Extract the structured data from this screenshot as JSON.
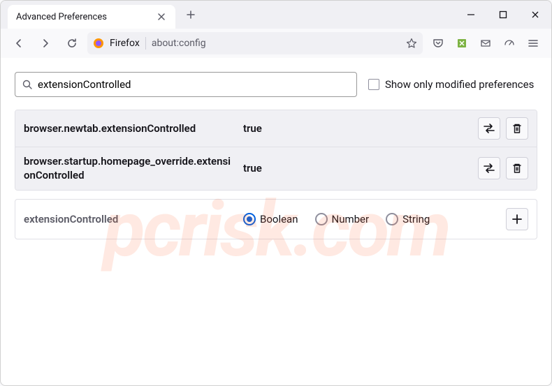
{
  "tab": {
    "title": "Advanced Preferences"
  },
  "urlbar": {
    "identity": "Firefox",
    "url": "about:config"
  },
  "search": {
    "value": "extensionControlled",
    "checkbox_label": "Show only modified preferences"
  },
  "prefs": [
    {
      "name": "browser.newtab.extensionControlled",
      "value": "true"
    },
    {
      "name": "browser.startup.homepage_override.extensionControlled",
      "value": "true"
    }
  ],
  "new_pref": {
    "name": "extensionControlled",
    "types": [
      "Boolean",
      "Number",
      "String"
    ],
    "selected": "Boolean"
  },
  "watermark": "pcrisk.com"
}
